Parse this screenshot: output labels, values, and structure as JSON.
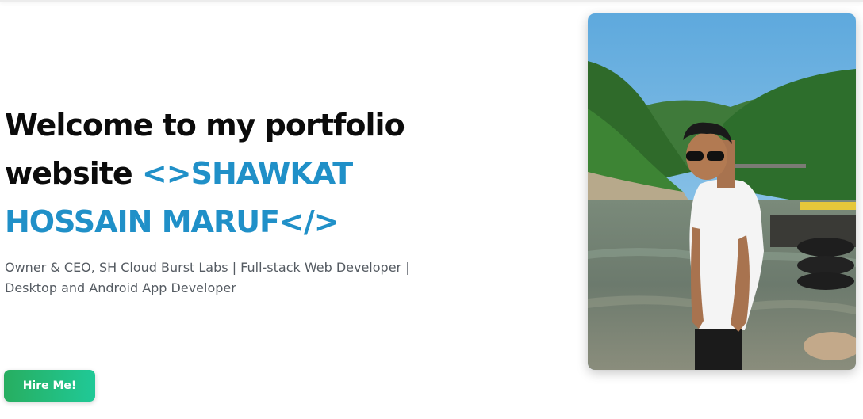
{
  "hero": {
    "headline_part1": "Welcome to my portfolio website ",
    "headline_accent": "<>SHAWKAT HOSSAIN MARUF</>",
    "subtitle": "Owner & CEO, SH Cloud Burst Labs | Full-stack Web Developer | Desktop and Android App Developer",
    "hire_button_label": "Hire Me!"
  },
  "colors": {
    "accent": "#2090c8",
    "button_start": "#27ae60",
    "button_end": "#20c997",
    "heading": "#0b0b0b",
    "body_text": "#555b62"
  }
}
